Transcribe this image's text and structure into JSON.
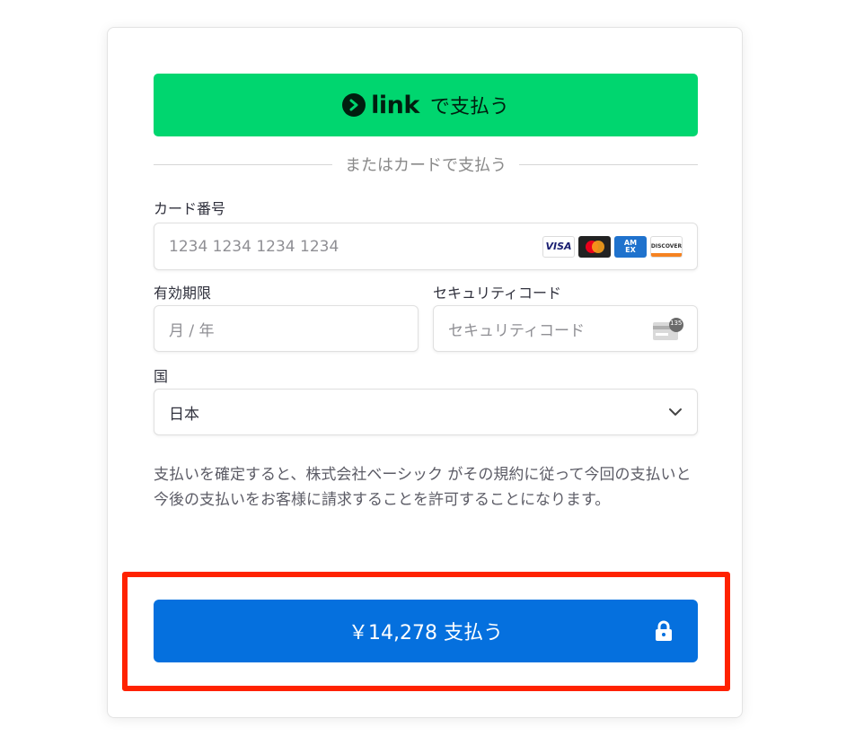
{
  "link_button": {
    "logo_word": "link",
    "label": "で支払う"
  },
  "divider": {
    "text": "またはカードで支払う"
  },
  "card_number": {
    "label": "カード番号",
    "placeholder": "1234 1234 1234 1234",
    "brands": [
      "VISA",
      "mastercard",
      "AMEX",
      "DISCOVER"
    ]
  },
  "expiry": {
    "label": "有効期限",
    "placeholder": "月 / 年"
  },
  "cvc": {
    "label": "セキュリティコード",
    "placeholder": "セキュリティコード",
    "icon_badge": "135"
  },
  "country": {
    "label": "国",
    "value": "日本"
  },
  "consent": {
    "text": "支払いを確定すると、株式会社ベーシック がその規約に従って今回の支払いと今後の支払いをお客様に請求することを許可することになります。"
  },
  "pay_button": {
    "label": "￥14,278 支払う"
  },
  "colors": {
    "link_green": "#00d66f",
    "pay_blue": "#0570de",
    "highlight_red": "#ff2200"
  }
}
